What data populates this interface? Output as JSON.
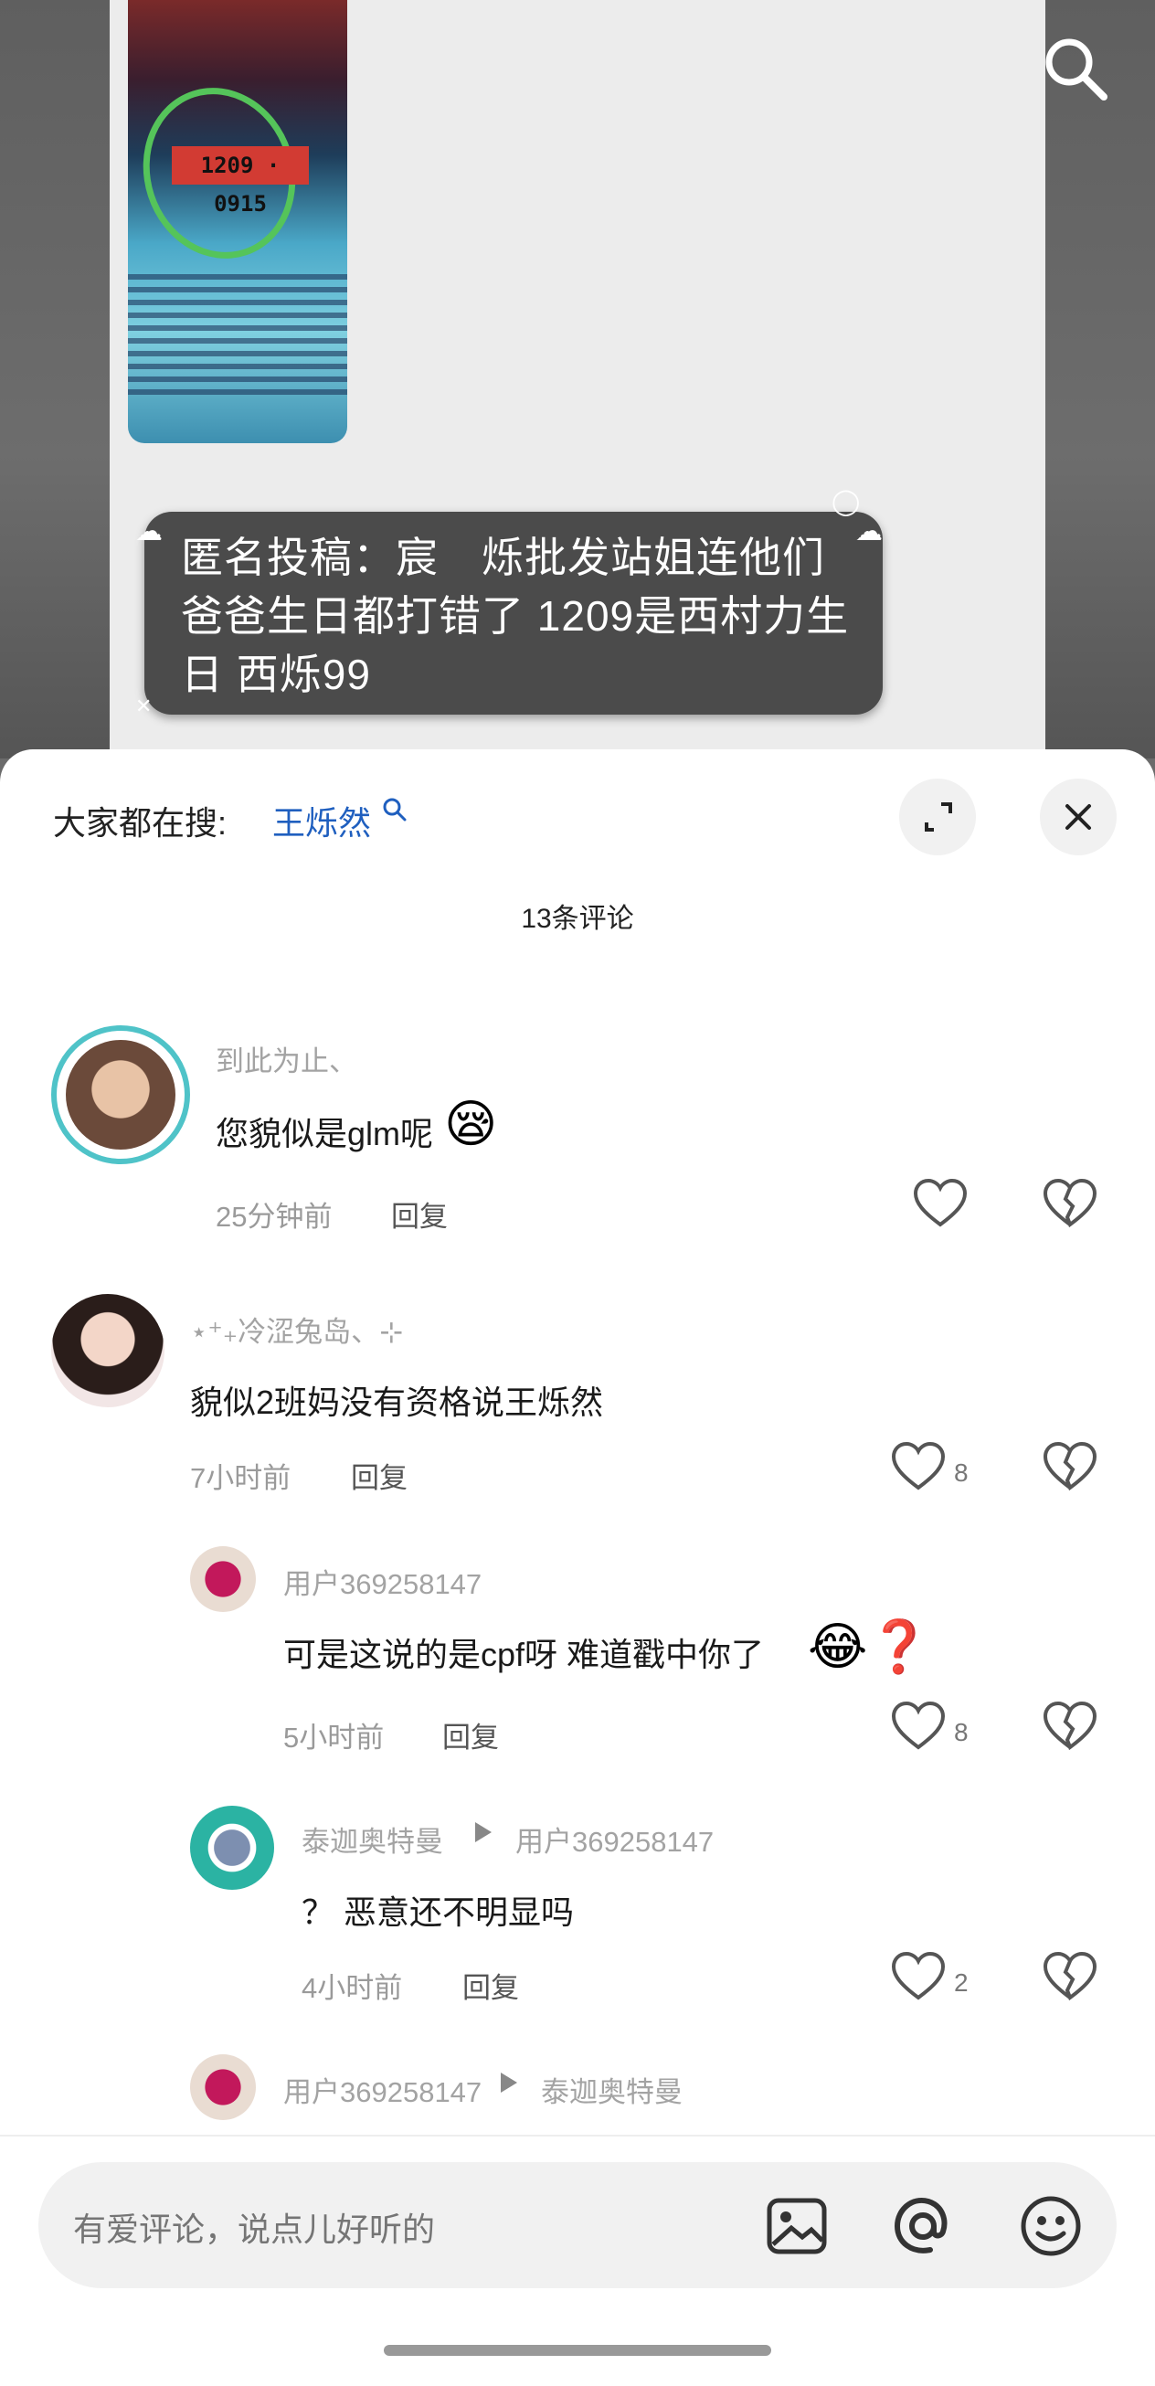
{
  "post": {
    "bubble_text": "匿名投稿：宸　烁批发站姐连他们爸爸生日都打错了 1209是西村力生日 西烁99",
    "image_stamp_text": "1209 · 0915"
  },
  "header": {
    "trending_label": "大家都在搜:",
    "trending_keyword": "王烁然"
  },
  "comments_count": "13条评论",
  "comments": [
    {
      "username": "到此为止、",
      "text": "您貌似是glm呢",
      "emoji": "😪",
      "time": "25分钟前",
      "reply_label": "回复",
      "likes": ""
    },
    {
      "username": "⋆⁺₊冷涩兔岛、⊹",
      "text": "貌似2班妈没有资格说王烁然",
      "time": "7小时前",
      "reply_label": "回复",
      "likes": "8"
    }
  ],
  "replies": [
    {
      "username": "用户369258147",
      "text": "可是这说的是cpf呀  难道戳中你了",
      "emoji": "😂❓",
      "time": "5小时前",
      "reply_label": "回复",
      "likes": "8"
    },
    {
      "username": "泰迦奥特曼",
      "reply_to": "用户369258147",
      "text": "？ 恶意还不明显吗",
      "time": "4小时前",
      "reply_label": "回复",
      "likes": "2"
    },
    {
      "username": "用户369258147",
      "reply_to": "泰迦奥特曼"
    }
  ],
  "input": {
    "placeholder": "有爱评论，说点儿好听的"
  },
  "icons": {
    "top_search": "search-icon",
    "expand": "expand-icon",
    "close": "close-icon",
    "like": "heart-icon",
    "dislike": "broken-heart-icon",
    "image": "image-icon",
    "mention": "at-icon",
    "emoji": "smiley-icon"
  },
  "colors": {
    "accent_link": "#1f5fbf",
    "sheet_bg": "#ffffff",
    "muted_text": "#a3a3a3"
  }
}
